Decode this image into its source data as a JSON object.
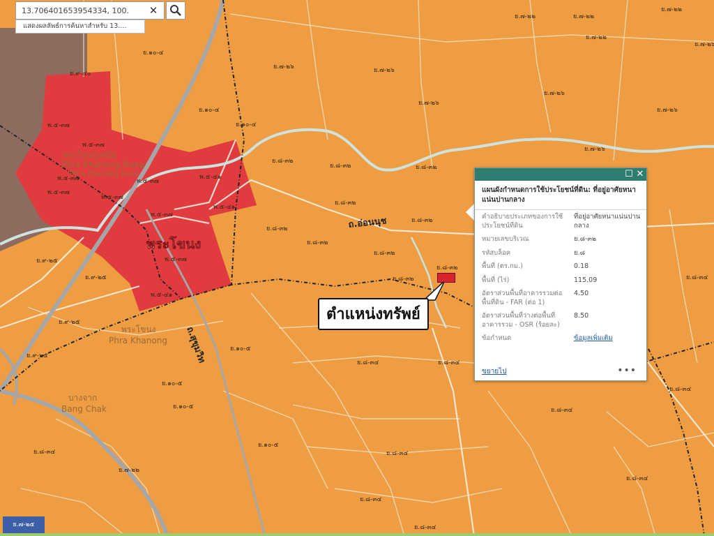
{
  "search": {
    "value": "13.706401653954334, 100.",
    "clear_icon": "close-icon",
    "search_icon": "search-icon",
    "suggestion": "แสดงผลลัพธ์การค้นหาสำหรับ 13...."
  },
  "map": {
    "colors": {
      "residential_medium": "#ee9d43",
      "commercial": "#e03b3f",
      "brown_zone": "#8d6b5e",
      "canal": "#cfe3de",
      "boundary": "#222222"
    },
    "zone_labels": [
      "ย.๑๐-๔",
      "ย.๗-๒๒",
      "ย.๗-๒๒",
      "ย.๗-๒๒",
      "ย.๗-๒๒",
      "ย.๗-๒๖",
      "ย.๗-๒๖",
      "ย.๗-๒๖",
      "ย.๑๐-๔",
      "ย.๑๐-๔",
      "ย.๗-๒๖",
      "ย.๗-๒๖",
      "ย.๗-๒๖",
      "ย.๗-๒๖",
      "ย.๘-๓๒",
      "ย.๘-๓๒",
      "ย.๘-๓๒",
      "ย.๘-๓๒",
      "ย.๘-๓๒",
      "ย.๘-๓๒",
      "ย.๘-๓๒",
      "ย.๘-๓๒",
      "ย.๘-๓๒",
      "ย.๘-๓๒",
      "ย.๙-๒๕",
      "ย.๙-๒๕",
      "ย.๙-๒๕",
      "ย.๙-๒๕",
      "ย.๑๐-๕",
      "ย.๑๐-๕",
      "ย.๑๐-๕",
      "ย.๘-๓๔",
      "ย.๘-๓๔",
      "ย.๘-๓๔",
      "ย.๘-๓๔",
      "ย.๘-๓๔",
      "ย.๘-๓๔",
      "ย.๘-๓๔",
      "ย.๘-๓๔",
      "ย.๘-๓๔",
      "ย.๗-๒๒",
      "ย.๑๐-๕",
      "ย.๙-๔๐",
      "ย.๘-๓๔"
    ],
    "commercial_labels": [
      "พ.๕-๓๗",
      "พ.๕-๓๗",
      "พ.๕-๓๗",
      "พ.๕-๓๗",
      "พ.๕-๓๗",
      "พ.๕-๓๗",
      "พ.๕-๔๑",
      "พ.๕-๔๑",
      "พ.๕-๔๑",
      "พ.๕-๓๗",
      "พ.๕-๓๗"
    ],
    "district_labels": [
      {
        "th": "พระโขนงเหนือ",
        "en": "Phra Khanong Nuea"
      },
      {
        "th": "พระโขนง",
        "en": "Phra Khanong"
      },
      {
        "th": "บางจาก",
        "en": "Bang Chak"
      }
    ],
    "road_labels": [
      "ถ.อ่อนนุช",
      "ถ.สุขุมวิท"
    ],
    "big_label": "พระโขนง",
    "scale_badge": "ย.๗-๒๕"
  },
  "popup": {
    "title": "แผนผังกำหนดการใช้ประโยชน์ที่ดิน: ที่อยู่อาศัยหนาแน่นปานกลาง",
    "maximize_icon": "maximize-icon",
    "close_icon": "close-icon",
    "rows": [
      {
        "key": "คำอธิบายประเภทของการใช้ประโยชน์ที่ดิน",
        "value": "ที่อยู่อาศัยหนาแน่นปานกลาง"
      },
      {
        "key": "หมายเลขบริเวณ",
        "value": "ย.๘-๓๒"
      },
      {
        "key": "รหัสบล็อค",
        "value": "ย.๘"
      },
      {
        "key": "พื้นที่ (ตร.กม.)",
        "value": "0.18"
      },
      {
        "key": "พื้นที่ (ไร่)",
        "value": "115.09"
      },
      {
        "key": "อัตราส่วนพื้นที่อาคารรวมต่อพื้นที่ดิน - FAR (ต่อ 1)",
        "value": "4.50"
      },
      {
        "key": "อัตราส่วนพื้นที่ว่างต่อพื้นที่อาคารรวม - OSR (ร้อยละ)",
        "value": "8.50"
      },
      {
        "key": "ข้อกำหนด",
        "value": "ข้อมูลเพิ่มเติม"
      }
    ],
    "zoom_label": "ขยายไป",
    "more_label": "•••"
  },
  "callout": {
    "label": "ตำแหน่งทรัพย์",
    "marker_label": "ย.๘-๓๒"
  }
}
